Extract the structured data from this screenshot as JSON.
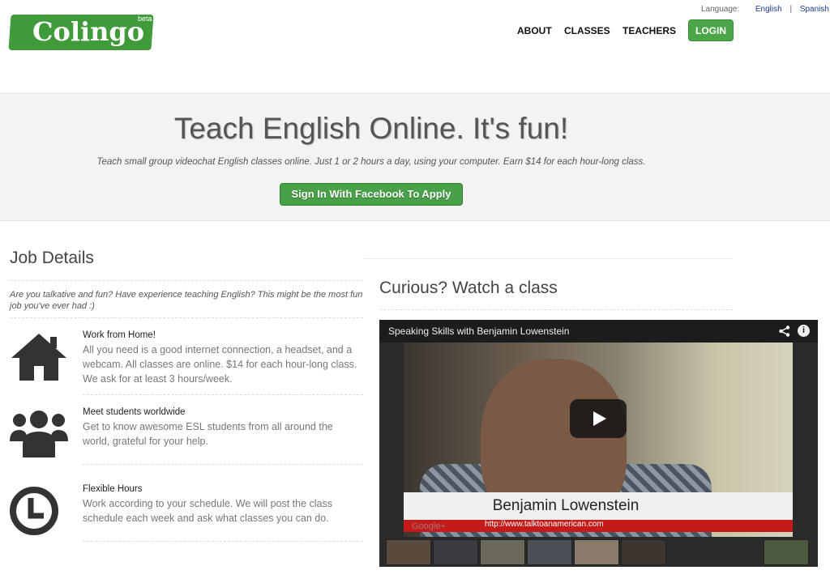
{
  "brand": {
    "name": "Colingo",
    "tag": "beta",
    "color": "#3f9a3a"
  },
  "language_bar": {
    "label": "Language:",
    "options": [
      "English",
      "Spanish"
    ]
  },
  "nav": {
    "items": [
      "ABOUT",
      "CLASSES",
      "TEACHERS"
    ],
    "login": "LOGIN"
  },
  "hero": {
    "title": "Teach English Online. It's fun!",
    "subtitle": "Teach small group videochat English classes online. Just 1 or 2 hours a day, using your computer. Earn $14 for each hour-long class.",
    "cta": "Sign In With Facebook To Apply"
  },
  "job": {
    "title": "Job Details",
    "intro": "Are you talkative and fun? Have experience teaching English? This might be the most fun job you've ever had :)",
    "features": [
      {
        "icon": "house-icon",
        "title": "Work from Home!",
        "text": "All you need is a good internet connection, a headset, and a webcam. All classes are online. $14 for each hour-long class. We ask for at least 3 hours/week."
      },
      {
        "icon": "people-icon",
        "title": "Meet students worldwide",
        "text": "Get to know awesome ESL students from all around the world, grateful for your help."
      },
      {
        "icon": "clock-icon",
        "title": "Flexible Hours",
        "text": "Work according to your schedule. We will post the class schedule each week and ask what classes you can do."
      }
    ]
  },
  "video": {
    "heading": "Curious? Watch a class",
    "title": "Speaking Skills with Benjamin Lowenstein",
    "caption_name": "Benjamin Lowenstein",
    "caption_url": "http://www.talktoanamerican.com",
    "watermark": "Google+",
    "icons": [
      "share-icon",
      "info-icon",
      "play-icon"
    ]
  }
}
